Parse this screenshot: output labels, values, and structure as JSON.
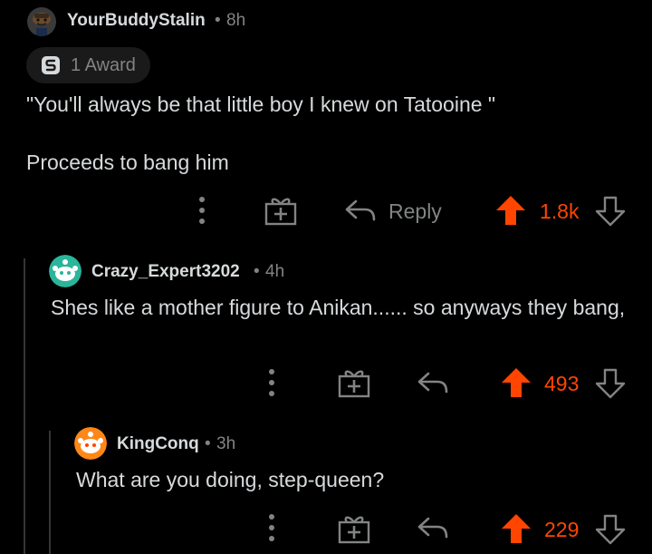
{
  "comments": [
    {
      "username": "YourBuddyStalin",
      "time": "8h",
      "award_label": "1 Award",
      "award_icon": "silver-award-icon",
      "body_lines": [
        "\"You'll always be that little boy I knew on Tatooine \"",
        "Proceeds to bang him"
      ],
      "reply_label": "Reply",
      "score": "1.8k"
    },
    {
      "username": "Crazy_Expert3202",
      "time": "4h",
      "body": "Shes like a mother figure to Anikan...... so anyways they bang,",
      "score": "493"
    },
    {
      "username": "KingConq",
      "time": "3h",
      "body": "What are you doing, step-queen?",
      "score": "229"
    }
  ],
  "separator": "•",
  "colors": {
    "background": "#000000",
    "text": "#d7dadc",
    "muted": "#818384",
    "upvote": "#ff4500",
    "thread_line": "#343536"
  }
}
